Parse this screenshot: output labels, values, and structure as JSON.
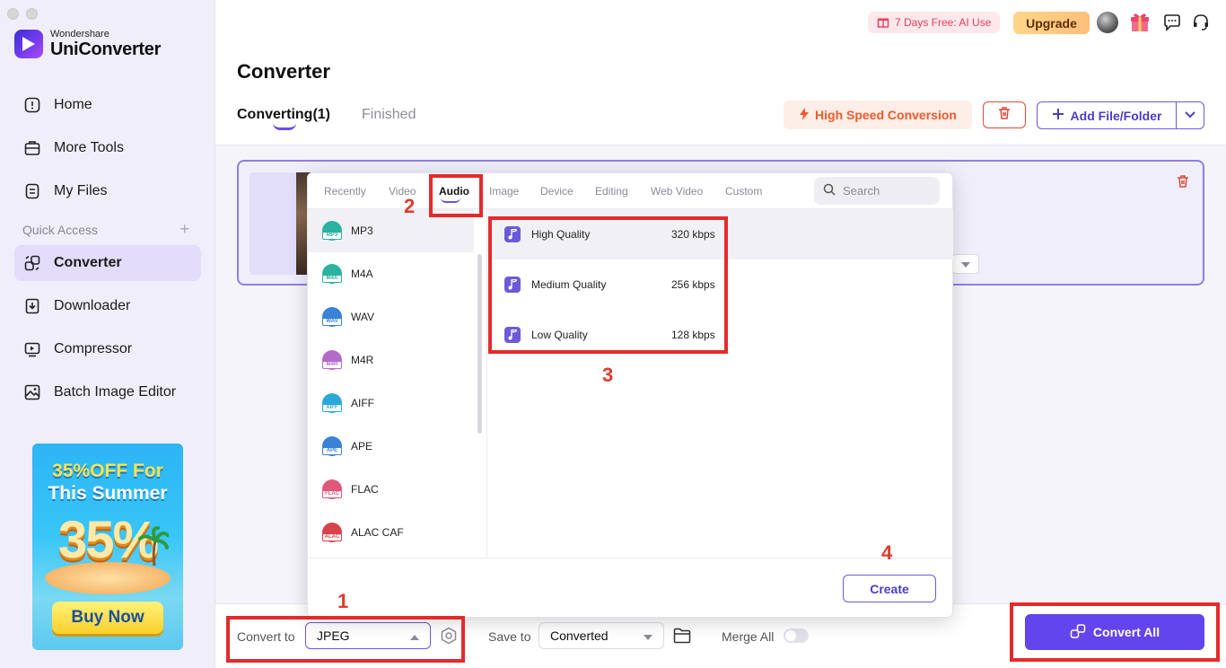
{
  "app": {
    "brand_small": "Wondershare",
    "brand_big": "UniConverter"
  },
  "sidebar": {
    "items": [
      {
        "label": "Home",
        "icon": "home-icon"
      },
      {
        "label": "More Tools",
        "icon": "toolbox-icon"
      },
      {
        "label": "My Files",
        "icon": "file-icon"
      }
    ],
    "quick_access_label": "Quick Access",
    "quick_access_add": "+",
    "quick_items": [
      {
        "label": "Converter",
        "icon": "converter-icon",
        "active": true
      },
      {
        "label": "Downloader",
        "icon": "download-icon"
      },
      {
        "label": "Compressor",
        "icon": "compress-icon"
      },
      {
        "label": "Batch Image Editor",
        "icon": "image-edit-icon"
      }
    ],
    "promo": {
      "line1": "35%OFF For",
      "line2": "This Summer",
      "big": "35%",
      "button": "Buy Now"
    }
  },
  "topbar": {
    "trial": "7 Days Free: AI Use",
    "upgrade": "Upgrade"
  },
  "page": {
    "title": "Converter",
    "tabs": [
      {
        "label": "Converting(1)",
        "active": true
      },
      {
        "label": "Finished",
        "active": false
      }
    ],
    "high_speed": "High Speed Conversion",
    "add_file": "Add File/Folder"
  },
  "format_panel": {
    "tabs": [
      "Recently",
      "Video",
      "Audio",
      "Image",
      "Device",
      "Editing",
      "Web Video",
      "Custom"
    ],
    "active_tab": "Audio",
    "search_placeholder": "Search",
    "formats": [
      {
        "label": "MP3",
        "tag": "MP3",
        "color": "#2bb3a0"
      },
      {
        "label": "M4A",
        "tag": "M4A",
        "color": "#2bb3a0"
      },
      {
        "label": "WAV",
        "tag": "WAV",
        "color": "#3a82d6"
      },
      {
        "label": "M4R",
        "tag": "M4R",
        "color": "#b56acb"
      },
      {
        "label": "AIFF",
        "tag": "AIFF",
        "color": "#2ca8d8"
      },
      {
        "label": "APE",
        "tag": "APE",
        "color": "#3a82d6"
      },
      {
        "label": "FLAC",
        "tag": "FLAC",
        "color": "#e0577a"
      },
      {
        "label": "ALAC CAF",
        "tag": "ALAC",
        "color": "#d9434b"
      }
    ],
    "qualities": [
      {
        "label": "High Quality",
        "rate": "320 kbps"
      },
      {
        "label": "Medium Quality",
        "rate": "256 kbps"
      },
      {
        "label": "Low Quality",
        "rate": "128 kbps"
      }
    ],
    "create": "Create"
  },
  "bottom": {
    "convert_to_label": "Convert to",
    "convert_to_value": "JPEG",
    "save_to_label": "Save to",
    "save_to_value": "Converted",
    "merge_label": "Merge All",
    "convert_all": "Convert All"
  },
  "annotations": {
    "n1": "1",
    "n2": "2",
    "n3": "3",
    "n4": "4"
  },
  "colors": {
    "accent": "#6245ec",
    "annotation": "#e32b2b"
  }
}
